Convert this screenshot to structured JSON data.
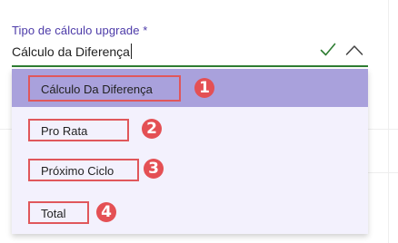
{
  "field": {
    "label": "Tipo de cálculo upgrade *",
    "value": "Cálculo da Diferença",
    "confirm_icon": "check-icon",
    "toggle_icon": "chevron-up-icon"
  },
  "dropdown": {
    "options": [
      {
        "label": "Cálculo Da Diferença",
        "selected": true,
        "badge": "1"
      },
      {
        "label": "Pro Rata",
        "selected": false,
        "badge": "2"
      },
      {
        "label": "Próximo Ciclo",
        "selected": false,
        "badge": "3"
      },
      {
        "label": "Total",
        "selected": false,
        "badge": "4"
      }
    ]
  },
  "colors": {
    "label": "#4c3aa8",
    "underline": "#2e7d32",
    "check": "#2e7d32",
    "selected_option": "#a9a1dc",
    "menu_background": "#f3f1fd",
    "annotation": "#e45054"
  }
}
